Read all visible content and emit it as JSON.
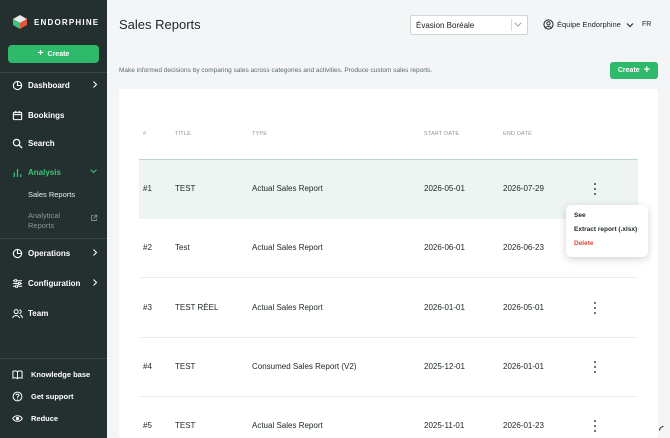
{
  "brand": {
    "name": "ENDORPHINE",
    "accent": "#2fb96b",
    "sidebar_bg": "#23302f"
  },
  "sidebar": {
    "create_label": "Create",
    "items": [
      {
        "label": "Dashboard",
        "icon": "pie-chart-icon",
        "has_chevron": true
      },
      {
        "label": "Bookings",
        "icon": "calendar-icon",
        "has_chevron": false
      },
      {
        "label": "Search",
        "icon": "search-icon",
        "has_chevron": false
      },
      {
        "label": "Analysis",
        "icon": "bar-chart-icon",
        "has_chevron": true,
        "active": true
      },
      {
        "label": "Operations",
        "icon": "pie-chart-icon",
        "has_chevron": true
      },
      {
        "label": "Configuration",
        "icon": "sliders-icon",
        "has_chevron": true
      },
      {
        "label": "Team",
        "icon": "users-icon",
        "has_chevron": false
      }
    ],
    "sub_items": [
      {
        "label": "Sales Reports"
      },
      {
        "label": "Analytical",
        "label2": "Reports",
        "external": true
      }
    ],
    "footer": [
      {
        "label": "Knowledge base",
        "icon": "book-icon"
      },
      {
        "label": "Get support",
        "icon": "help-icon"
      },
      {
        "label": "Reduce",
        "icon": "eye-icon"
      }
    ]
  },
  "header": {
    "title": "Sales Reports",
    "company_select": "Évasion Boréale",
    "account": "Équipe Endorphine",
    "language": "FR"
  },
  "main": {
    "description": "Make informed decisions by comparing sales across categories and activities. Produce custom sales reports.",
    "create_label": "Create",
    "columns": [
      "#",
      "TITLE",
      "TYPE",
      "START DATE",
      "END DATE"
    ],
    "rows": [
      {
        "num": "#1",
        "title": "TEST",
        "type": "Actual Sales Report",
        "start": "2026-05-01",
        "end": "2026-07-29",
        "selected": true
      },
      {
        "num": "#2",
        "title": "Test",
        "type": "Actual Sales Report",
        "start": "2026-06-01",
        "end": "2026-06-23"
      },
      {
        "num": "#3",
        "title": "TEST RÉEL",
        "type": "Actual Sales Report",
        "start": "2026-01-01",
        "end": "2026-05-01"
      },
      {
        "num": "#4",
        "title": "TEST",
        "type": "Consumed Sales Report (V2)",
        "start": "2025-12-01",
        "end": "2026-01-01"
      },
      {
        "num": "#5",
        "title": "TEST",
        "type": "Actual Sales Report",
        "start": "2025-11-01",
        "end": "2026-01-23"
      }
    ]
  },
  "row_menu": {
    "see": "See",
    "extract": "Extract report (.xlsx)",
    "delete": "Delete"
  }
}
